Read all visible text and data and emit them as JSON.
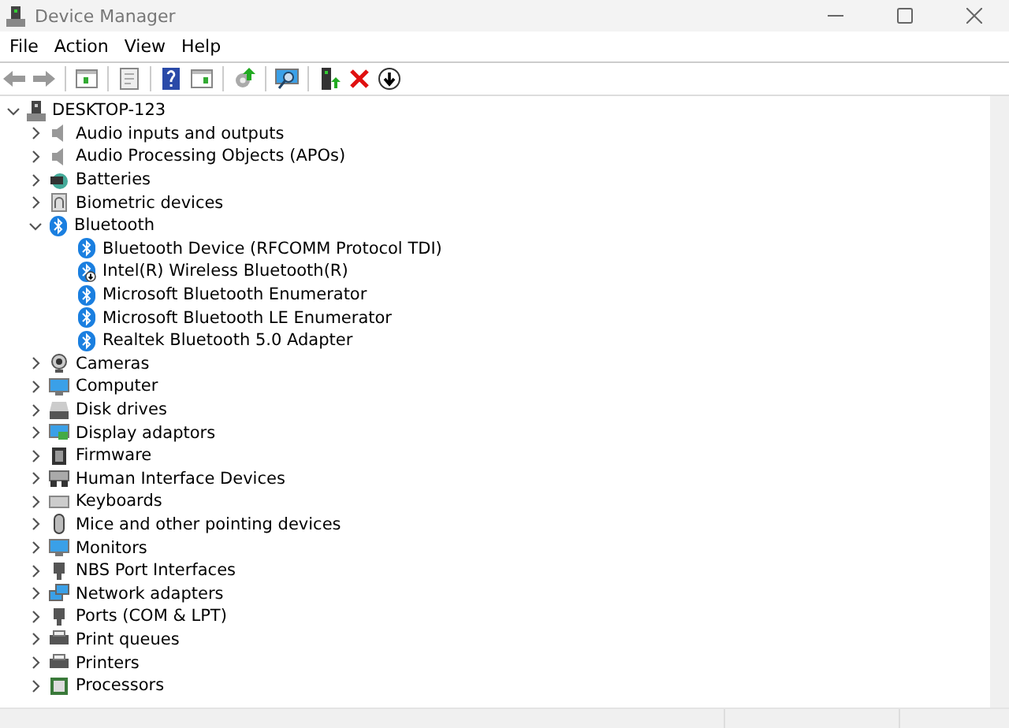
{
  "window": {
    "title": "Device Manager"
  },
  "menu": [
    "File",
    "Action",
    "View",
    "Help"
  ],
  "tree": {
    "label": "DESKTOP-123",
    "expanded": true,
    "children": [
      {
        "label": "Audio inputs and outputs",
        "expanded": false
      },
      {
        "label": "Audio Processing Objects (APOs)",
        "expanded": false
      },
      {
        "label": "Batteries",
        "expanded": false
      },
      {
        "label": "Biometric devices",
        "expanded": false
      },
      {
        "label": "Bluetooth",
        "expanded": true,
        "children": [
          {
            "label": "Bluetooth Device (RFCOMM Protocol TDI)",
            "disabled": false
          },
          {
            "label": "Intel(R) Wireless Bluetooth(R)",
            "disabled": true
          },
          {
            "label": "Microsoft Bluetooth Enumerator",
            "disabled": false
          },
          {
            "label": "Microsoft Bluetooth LE Enumerator",
            "disabled": false
          },
          {
            "label": "Realtek Bluetooth 5.0 Adapter",
            "disabled": false
          }
        ]
      },
      {
        "label": "Cameras",
        "expanded": false
      },
      {
        "label": "Computer",
        "expanded": false
      },
      {
        "label": "Disk drives",
        "expanded": false
      },
      {
        "label": "Display adaptors",
        "expanded": false
      },
      {
        "label": "Firmware",
        "expanded": false
      },
      {
        "label": "Human Interface Devices",
        "expanded": false
      },
      {
        "label": "Keyboards",
        "expanded": false
      },
      {
        "label": "Mice and other pointing devices",
        "expanded": false
      },
      {
        "label": "Monitors",
        "expanded": false
      },
      {
        "label": "NBS Port Interfaces",
        "expanded": false
      },
      {
        "label": "Network adapters",
        "expanded": false
      },
      {
        "label": "Ports (COM & LPT)",
        "expanded": false
      },
      {
        "label": "Print queues",
        "expanded": false
      },
      {
        "label": "Printers",
        "expanded": false
      },
      {
        "label": "Processors",
        "expanded": false
      }
    ]
  }
}
